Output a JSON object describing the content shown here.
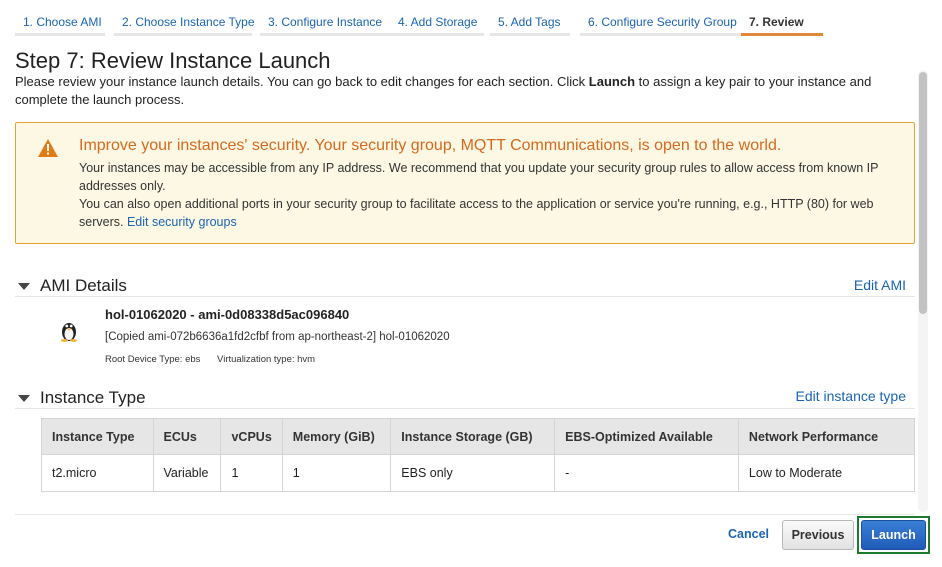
{
  "wizard": {
    "steps": [
      {
        "label": "1. Choose AMI"
      },
      {
        "label": "2. Choose Instance Type"
      },
      {
        "label": "3. Configure Instance"
      },
      {
        "label": "4. Add Storage"
      },
      {
        "label": "5. Add Tags"
      },
      {
        "label": "6. Configure Security Group"
      },
      {
        "label": "7. Review"
      }
    ],
    "active_step": 7
  },
  "page": {
    "title": "Step 7: Review Instance Launch",
    "intro_before": "Please review your instance launch details. You can go back to edit changes for each section. Click ",
    "intro_bold": "Launch",
    "intro_after": " to assign a key pair to your instance and complete the launch process."
  },
  "alert": {
    "icon": "warning-icon",
    "title": "Improve your instances' security. Your security group, MQTT Communications, is open to the world.",
    "line1": "Your instances may be accessible from any IP address. We recommend that you update your security group rules to allow access from known IP addresses only.",
    "line2": "You can also open additional ports in your security group to facilitate access to the application or service you're running, e.g., HTTP (80) for web servers.",
    "link": "Edit security groups",
    "color": "#d6691e"
  },
  "ami": {
    "section_title": "AMI Details",
    "edit_label": "Edit AMI",
    "icon": "linux-tux-icon",
    "name": "hol-01062020 - ami-0d08338d5ac096840",
    "description": "[Copied ami-072b6636a1fd2cfbf from ap-northeast-2] hol-01062020",
    "root_device": "Root Device Type: ebs",
    "virtualization": "Virtualization type: hvm"
  },
  "instance_type": {
    "section_title": "Instance Type",
    "edit_label": "Edit instance type",
    "columns": [
      "Instance Type",
      "ECUs",
      "vCPUs",
      "Memory (GiB)",
      "Instance Storage (GB)",
      "EBS-Optimized Available",
      "Network Performance"
    ],
    "rows": [
      [
        "t2.micro",
        "Variable",
        "1",
        "1",
        "EBS only",
        "-",
        "Low to Moderate"
      ]
    ]
  },
  "footer": {
    "cancel_label": "Cancel",
    "previous_label": "Previous",
    "launch_label": "Launch"
  }
}
